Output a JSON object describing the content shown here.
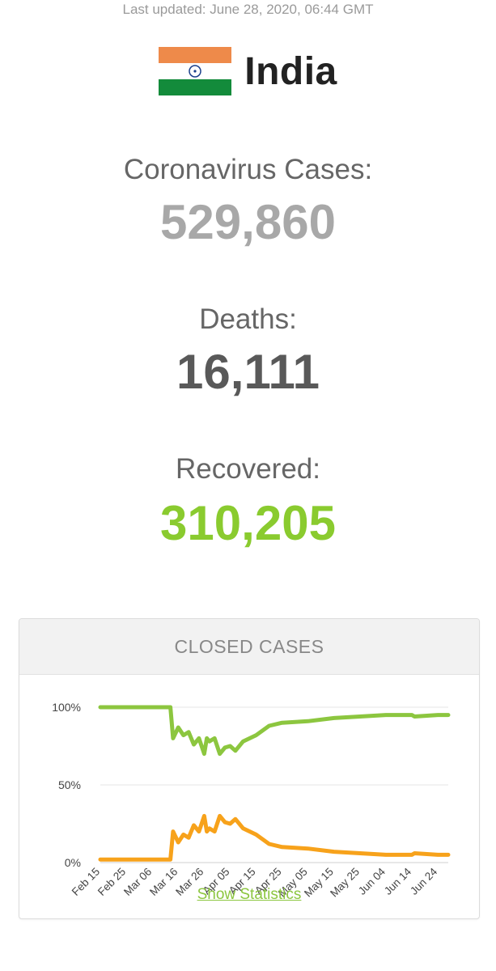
{
  "last_updated": "Last updated: June 28, 2020, 06:44 GMT",
  "country": {
    "name": "India",
    "flag_colors": {
      "saffron": "#ee8a4a",
      "white": "#ffffff",
      "green": "#138b3b",
      "chakra": "#1b3f8b"
    }
  },
  "stats": {
    "cases": {
      "label": "Coronavirus Cases:",
      "value": "529,860",
      "color": "#a8a8a8"
    },
    "deaths": {
      "label": "Deaths:",
      "value": "16,111",
      "color": "#595959"
    },
    "recovered": {
      "label": "Recovered:",
      "value": "310,205",
      "color": "#8acb2f"
    }
  },
  "closed_cases": {
    "title": "CLOSED CASES",
    "show_stats_label": "Show Statistics"
  },
  "chart_data": {
    "type": "line",
    "title": "CLOSED CASES",
    "xlabel": "",
    "ylabel": "",
    "ylim": [
      0,
      100
    ],
    "y_ticks": [
      "0%",
      "50%",
      "100%"
    ],
    "x_tick_labels": [
      "Feb 15",
      "Feb 25",
      "Mar 06",
      "Mar 16",
      "Mar 26",
      "Apr 05",
      "Apr 15",
      "Apr 25",
      "May 05",
      "May 15",
      "May 25",
      "Jun 04",
      "Jun 14",
      "Jun 24"
    ],
    "grid": true,
    "series": [
      {
        "color": "#8cc63f",
        "x": [
          "Feb 15",
          "Mar 13",
          "Mar 14",
          "Mar 16",
          "Mar 18",
          "Mar 20",
          "Mar 22",
          "Mar 24",
          "Mar 26",
          "Mar 27",
          "Mar 28",
          "Mar 30",
          "Apr 01",
          "Apr 03",
          "Apr 05",
          "Apr 07",
          "Apr 10",
          "Apr 15",
          "Apr 20",
          "Apr 25",
          "May 05",
          "May 15",
          "May 25",
          "Jun 04",
          "Jun 14",
          "Jun 15",
          "Jun 24",
          "Jun 28"
        ],
        "values": [
          100,
          100,
          80,
          87,
          82,
          84,
          76,
          80,
          70,
          80,
          78,
          80,
          70,
          74,
          75,
          72,
          78,
          82,
          88,
          90,
          91,
          93,
          94,
          95,
          95,
          94,
          95,
          95
        ]
      },
      {
        "color": "#f7a21b",
        "x": [
          "Feb 15",
          "Mar 13",
          "Mar 14",
          "Mar 16",
          "Mar 18",
          "Mar 20",
          "Mar 22",
          "Mar 24",
          "Mar 26",
          "Mar 27",
          "Mar 28",
          "Mar 30",
          "Apr 01",
          "Apr 03",
          "Apr 05",
          "Apr 07",
          "Apr 10",
          "Apr 15",
          "Apr 20",
          "Apr 25",
          "May 05",
          "May 15",
          "May 25",
          "Jun 04",
          "Jun 14",
          "Jun 15",
          "Jun 24",
          "Jun 28"
        ],
        "values": [
          2,
          2,
          20,
          13,
          18,
          16,
          24,
          20,
          30,
          20,
          22,
          20,
          30,
          26,
          25,
          28,
          22,
          18,
          12,
          10,
          9,
          7,
          6,
          5,
          5,
          6,
          5,
          5
        ]
      }
    ]
  }
}
